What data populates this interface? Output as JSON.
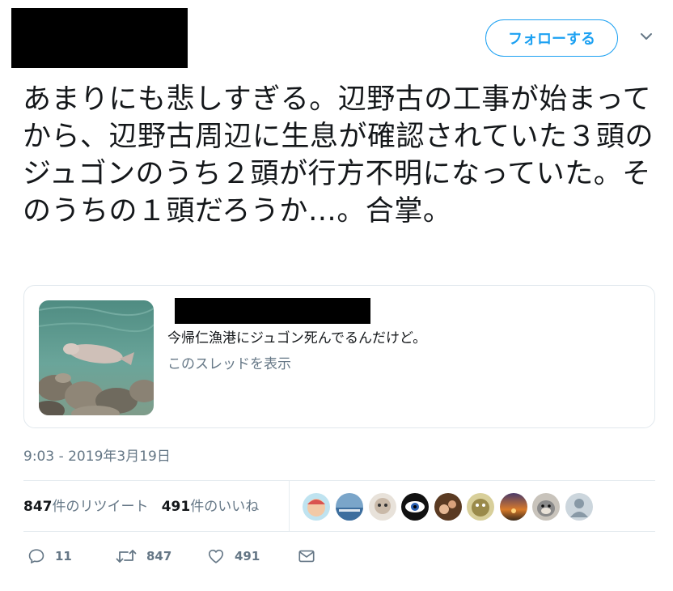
{
  "header": {
    "follow_label": "フォローする"
  },
  "tweet": {
    "text": "あまりにも悲しすぎる。辺野古の工事が始まってから、辺野古周辺に生息が確認されていた３頭のジュゴンのうち２頭が行方不明になっていた。そのうちの１頭だろうか…。合掌。",
    "timestamp": "9:03 - 2019年3月19日"
  },
  "quote": {
    "text": "今帰仁漁港にジュゴン死んでるんだけど。",
    "thread_link": "このスレッドを表示"
  },
  "stats": {
    "retweets_count": "847",
    "retweets_label": "件のリツイート",
    "likes_count": "491",
    "likes_label": "件のいいね"
  },
  "avatars": [
    {
      "name": "avatar-1",
      "color": "#d9534f"
    },
    {
      "name": "avatar-2",
      "color": "#3d6e9e"
    },
    {
      "name": "avatar-3",
      "color": "#c9b9a8"
    },
    {
      "name": "avatar-4",
      "color": "#111111"
    },
    {
      "name": "avatar-5",
      "color": "#5a3a22"
    },
    {
      "name": "avatar-6",
      "color": "#9a8a4a"
    },
    {
      "name": "avatar-7",
      "color": "#d87a2a"
    },
    {
      "name": "avatar-8",
      "color": "#8a8a8a"
    },
    {
      "name": "avatar-9",
      "color": "#ccd6dd"
    }
  ],
  "actions": {
    "reply_count": "11",
    "retweet_count": "847",
    "like_count": "491"
  },
  "colors": {
    "accent": "#1da1f2",
    "text": "#14171a",
    "secondary": "#657786",
    "border": "#e1e8ed"
  }
}
